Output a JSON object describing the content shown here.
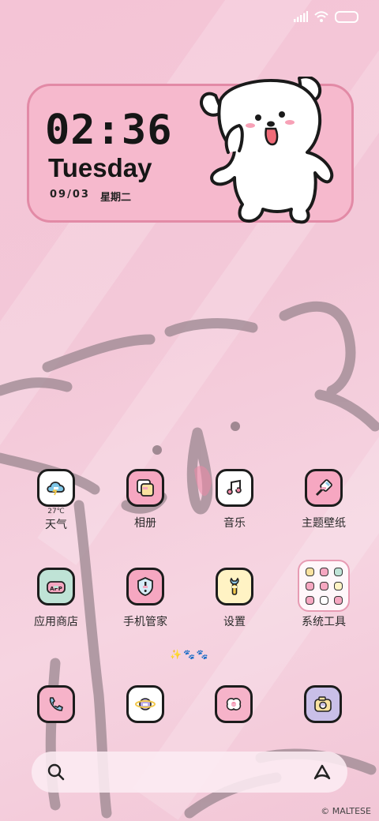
{
  "status": {
    "signal_icon": "signal-icon",
    "wifi_icon": "wifi-icon",
    "battery_icon": "battery-icon"
  },
  "clock": {
    "time": "02:36",
    "day": "Tuesday",
    "date": "09/03",
    "weekday": "星期二"
  },
  "apps": [
    {
      "label": "天气",
      "icon": "weather-icon",
      "extra": "27℃",
      "bg": "#ffffff"
    },
    {
      "label": "相册",
      "icon": "gallery-icon",
      "bg": "#f6a7c1"
    },
    {
      "label": "音乐",
      "icon": "music-icon",
      "bg": "#ffffff"
    },
    {
      "label": "主题壁纸",
      "icon": "theme-brush-icon",
      "bg": "#f6a7c1"
    },
    {
      "label": "应用商店",
      "icon": "app-store-icon",
      "bg": "#bfe3d6"
    },
    {
      "label": "手机管家",
      "icon": "security-shield-icon",
      "bg": "#f6a7c1"
    },
    {
      "label": "设置",
      "icon": "settings-wrench-icon",
      "bg": "#fff3c4"
    },
    {
      "label": "系统工具",
      "icon": "folder-icon"
    }
  ],
  "dock": [
    {
      "icon": "phone-icon",
      "bg": "#f6b3c9"
    },
    {
      "icon": "browser-planet-icon",
      "bg": "#ffffff"
    },
    {
      "icon": "messages-icon",
      "bg": "#f6b3c9"
    },
    {
      "icon": "camera-icon",
      "bg": "#c9bfe8"
    }
  ],
  "page_indicator": "✨🐾🐾",
  "search": {
    "search_icon": "search-icon",
    "assistant_icon": "assistant-icon"
  },
  "watermark": "© MALTESE"
}
